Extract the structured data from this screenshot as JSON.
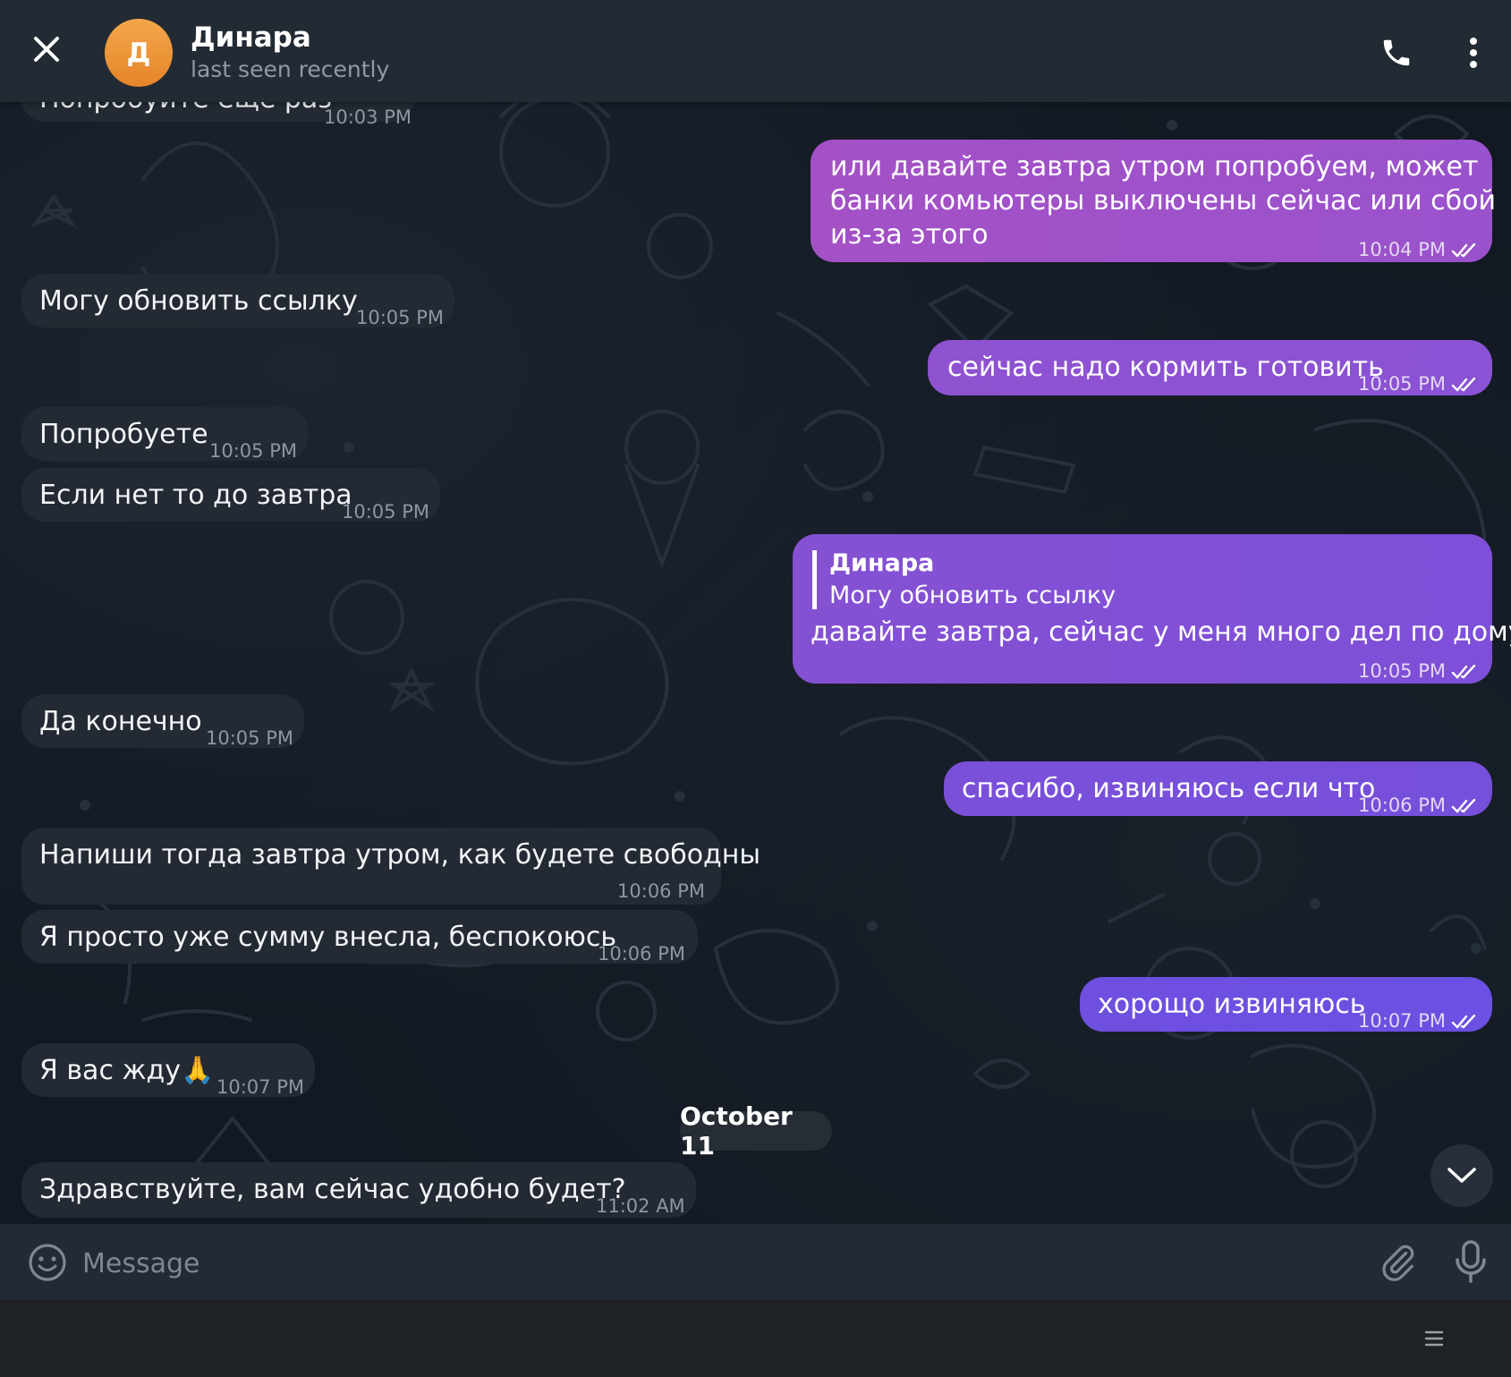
{
  "header": {
    "avatar_letter": "Д",
    "name": "Динара",
    "status": "last seen recently",
    "icons": [
      "close-icon",
      "phone-icon",
      "more-vertical-icon"
    ]
  },
  "messages": [
    {
      "dir": "in",
      "text": "Попробуйте еще раз",
      "time": "10:03 PM"
    },
    {
      "dir": "out",
      "lines": [
        "или давайте завтра утром попробуем, может",
        "банки комьютеры выключены сейчас или сбой",
        "из-за этого"
      ],
      "time": "10:04 PM"
    },
    {
      "dir": "in",
      "text": "Могу обновить ссылку",
      "time": "10:05 PM"
    },
    {
      "dir": "out",
      "text": "сейчас надо кормить готовить",
      "time": "10:05 PM"
    },
    {
      "dir": "in",
      "text": "Попробуете",
      "time": "10:05 PM"
    },
    {
      "dir": "in",
      "text": "Если нет то до завтра",
      "time": "10:05 PM"
    },
    {
      "dir": "out",
      "reply_name": "Динара",
      "reply_text": "Могу обновить ссылку",
      "text": "давайте завтра, сейчас у меня много дел по дому",
      "time": "10:05 PM"
    },
    {
      "dir": "in",
      "text": "Да конечно",
      "time": "10:05 PM"
    },
    {
      "dir": "out",
      "text": "спасибо, извиняюсь если что",
      "time": "10:06 PM"
    },
    {
      "dir": "in",
      "text": "Напиши тогда завтра утром, как будете свободны",
      "time": "10:06 PM"
    },
    {
      "dir": "in",
      "text": "Я просто уже сумму внесла, беспокоюсь",
      "time": "10:06 PM"
    },
    {
      "dir": "out",
      "text": "хорощо извиняюсь",
      "time": "10:07 PM"
    },
    {
      "dir": "in",
      "text": "Я вас жду🙏",
      "time": "10:07 PM"
    },
    {
      "dir": "in",
      "text": "Здравствуйте, вам сейчас удобно будет?",
      "time": "11:02 AM"
    }
  ],
  "date_separator": "October 11",
  "composer": {
    "placeholder": "Message",
    "icons": [
      "emoji-icon",
      "attach-icon",
      "microphone-icon"
    ]
  },
  "colors": {
    "accent_start": "#a253c8",
    "accent_end": "#6e4fe0",
    "incoming_bubble": "#232a33",
    "header": "#222a33"
  }
}
